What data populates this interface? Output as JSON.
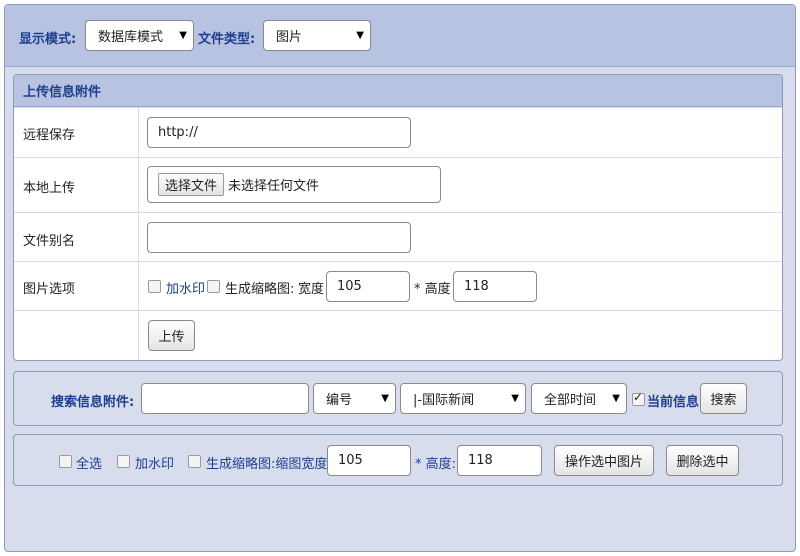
{
  "toolbar": {
    "display_mode_label": "显示模式:",
    "display_mode_value": "数据库模式",
    "file_type_label": "文件类型:",
    "file_type_value": "图片"
  },
  "upload": {
    "title": "上传信息附件",
    "remote_label": "远程保存",
    "remote_value": "http://",
    "local_label": "本地上传",
    "choose_file_button": "选择文件",
    "no_file_text": "未选择任何文件",
    "alias_label": "文件别名",
    "alias_value": "",
    "image_options_label": "图片选项",
    "watermark_label": "加水印",
    "thumbnail_label": "生成缩略图:",
    "width_label": "宽度",
    "width_value": "105",
    "height_label": "* 高度",
    "height_value": "118",
    "upload_button": "上传"
  },
  "search": {
    "label": "搜索信息附件:",
    "query_value": "",
    "field_select": "编号",
    "category_select": "|-国际新闻",
    "time_select": "全部时间",
    "current_info_label": "当前信息",
    "current_info_checked": true,
    "search_button": "搜索"
  },
  "batch": {
    "select_all_label": "全选",
    "watermark_label": "加水印",
    "thumbnail_label": "生成缩略图:缩图宽度:",
    "width_value": "105",
    "height_label": "* 高度:",
    "height_value": "118",
    "operate_button": "操作选中图片",
    "delete_button": "删除选中"
  },
  "icons": {
    "dropdown": "chevron-down-icon",
    "checkbox": "checkbox-icon"
  }
}
